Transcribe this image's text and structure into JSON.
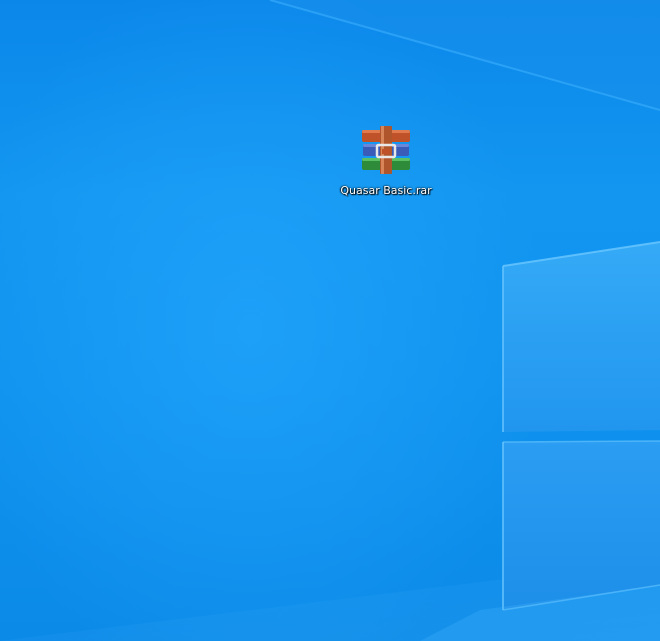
{
  "desktop": {
    "icons": [
      {
        "label": "Quasar Basic.rar",
        "icon": "winrar-archive-icon"
      }
    ]
  },
  "colors": {
    "background": "#0f93ef",
    "window_pane": "#2aa3f5",
    "icon_red": "#c0522a",
    "icon_blue": "#3b5bb8",
    "icon_green": "#2e8b3a"
  }
}
